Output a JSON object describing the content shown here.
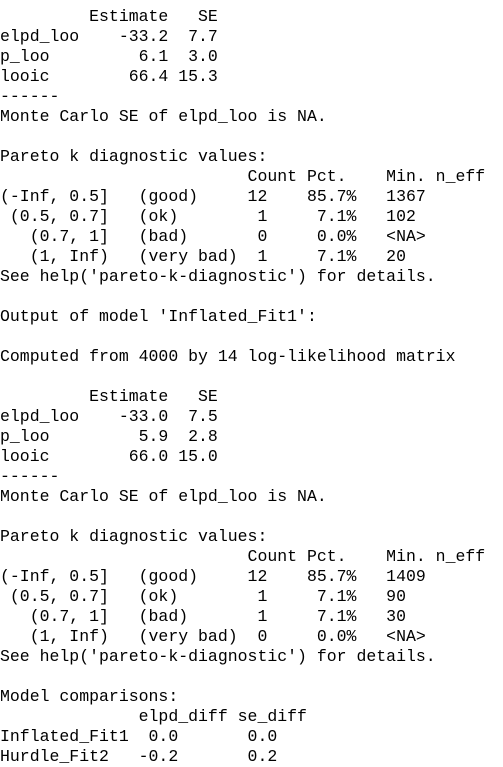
{
  "console": {
    "lines": [
      "         Estimate   SE",
      "elpd_loo    -33.2  7.7",
      "p_loo         6.1  3.0",
      "looic        66.4 15.3",
      "------",
      "Monte Carlo SE of elpd_loo is NA.",
      "",
      "Pareto k diagnostic values:",
      "                         Count Pct.    Min. n_eff",
      "(-Inf, 0.5]   (good)     12    85.7%   1367",
      " (0.5, 0.7]   (ok)        1     7.1%   102",
      "   (0.7, 1]   (bad)       0     0.0%   <NA>",
      "   (1, Inf)   (very bad)  1     7.1%   20",
      "See help('pareto-k-diagnostic') for details.",
      "",
      "Output of model 'Inflated_Fit1':",
      "",
      "Computed from 4000 by 14 log-likelihood matrix",
      "",
      "         Estimate   SE",
      "elpd_loo    -33.0  7.5",
      "p_loo         5.9  2.8",
      "looic        66.0 15.0",
      "------",
      "Monte Carlo SE of elpd_loo is NA.",
      "",
      "Pareto k diagnostic values:",
      "                         Count Pct.    Min. n_eff",
      "(-Inf, 0.5]   (good)     12    85.7%   1409",
      " (0.5, 0.7]   (ok)        1     7.1%   90",
      "   (0.7, 1]   (bad)       1     7.1%   30",
      "   (1, Inf)   (very bad)  0     0.0%   <NA>",
      "See help('pareto-k-diagnostic') for details.",
      "",
      "Model comparisons:",
      "              elpd_diff se_diff",
      "Inflated_Fit1  0.0       0.0",
      "Hurdle_Fit2   -0.2       0.2"
    ]
  }
}
